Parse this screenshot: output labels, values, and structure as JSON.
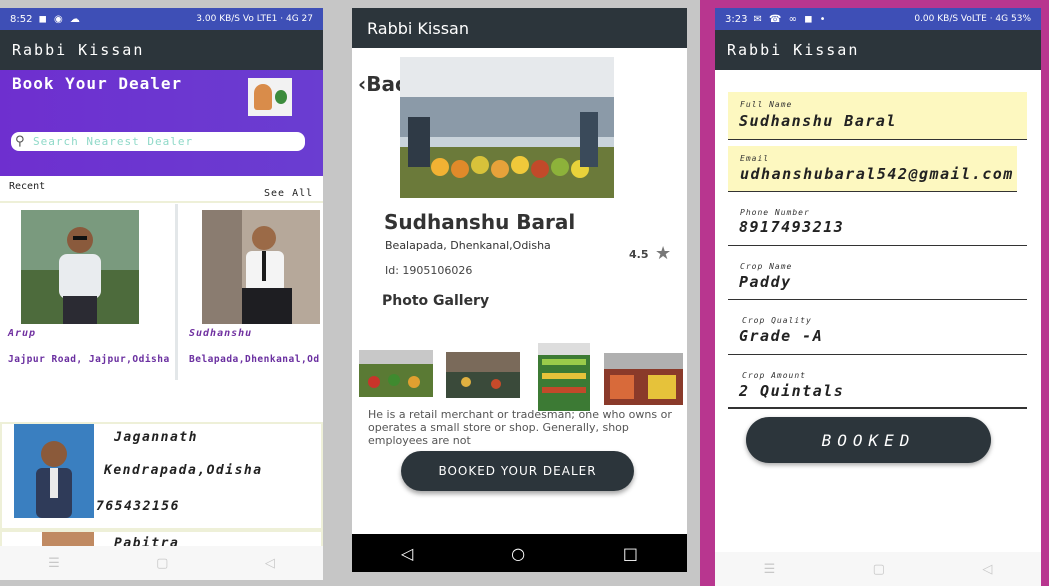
{
  "phone1": {
    "status": {
      "time": "8:52",
      "right": "3.00 KB/S Vo LTE1 · 4G 27"
    },
    "app_title": "Rabbi Kissan",
    "header_title": "Book Your Dealer",
    "search_placeholder": "Search Nearest Dealer",
    "recent_label": "Recent",
    "see_all": "See All",
    "recent": [
      {
        "name": "Arup",
        "address": "Jajpur Road, Jajpur,Odisha"
      },
      {
        "name": "Sudhanshu",
        "address": "Belapada,Dhenkanal,Od"
      }
    ],
    "dealers": [
      {
        "name": "Jagannath",
        "address": "Kendrapada,Odisha",
        "phone": "765432156"
      },
      {
        "name": "Pabitra"
      }
    ]
  },
  "phone2": {
    "app_title": "Rabbi Kissan",
    "back": "Back",
    "dealer_name": "Sudhanshu Baral",
    "location": "Bealapada, Dhenkanal,Odisha",
    "rating": "4.5",
    "id_label": "Id: 1905106026",
    "gallery_title": "Photo Gallery",
    "description": "He is a retail merchant or tradesman; one who owns or operates a small store or shop. Generally, shop employees are not",
    "book_button": "BOOKED YOUR DEALER"
  },
  "phone3": {
    "status": {
      "time": "3:23",
      "right": "0.00 KB/S VoLTE · 4G 53%"
    },
    "app_title": "Rabbi Kissan",
    "fields": [
      {
        "label": "Full Name",
        "value": "Sudhanshu Baral"
      },
      {
        "label": "Email",
        "value": "udhanshubaral542@gmail.com"
      },
      {
        "label": "Phone Number",
        "value": "8917493213"
      },
      {
        "label": "Crop Name",
        "value": "Paddy"
      },
      {
        "label": "Crop Quality",
        "value": "Grade -A"
      },
      {
        "label": "Crop Amount",
        "value": "2 Quintals"
      }
    ],
    "booked_button": "BOOKED"
  }
}
